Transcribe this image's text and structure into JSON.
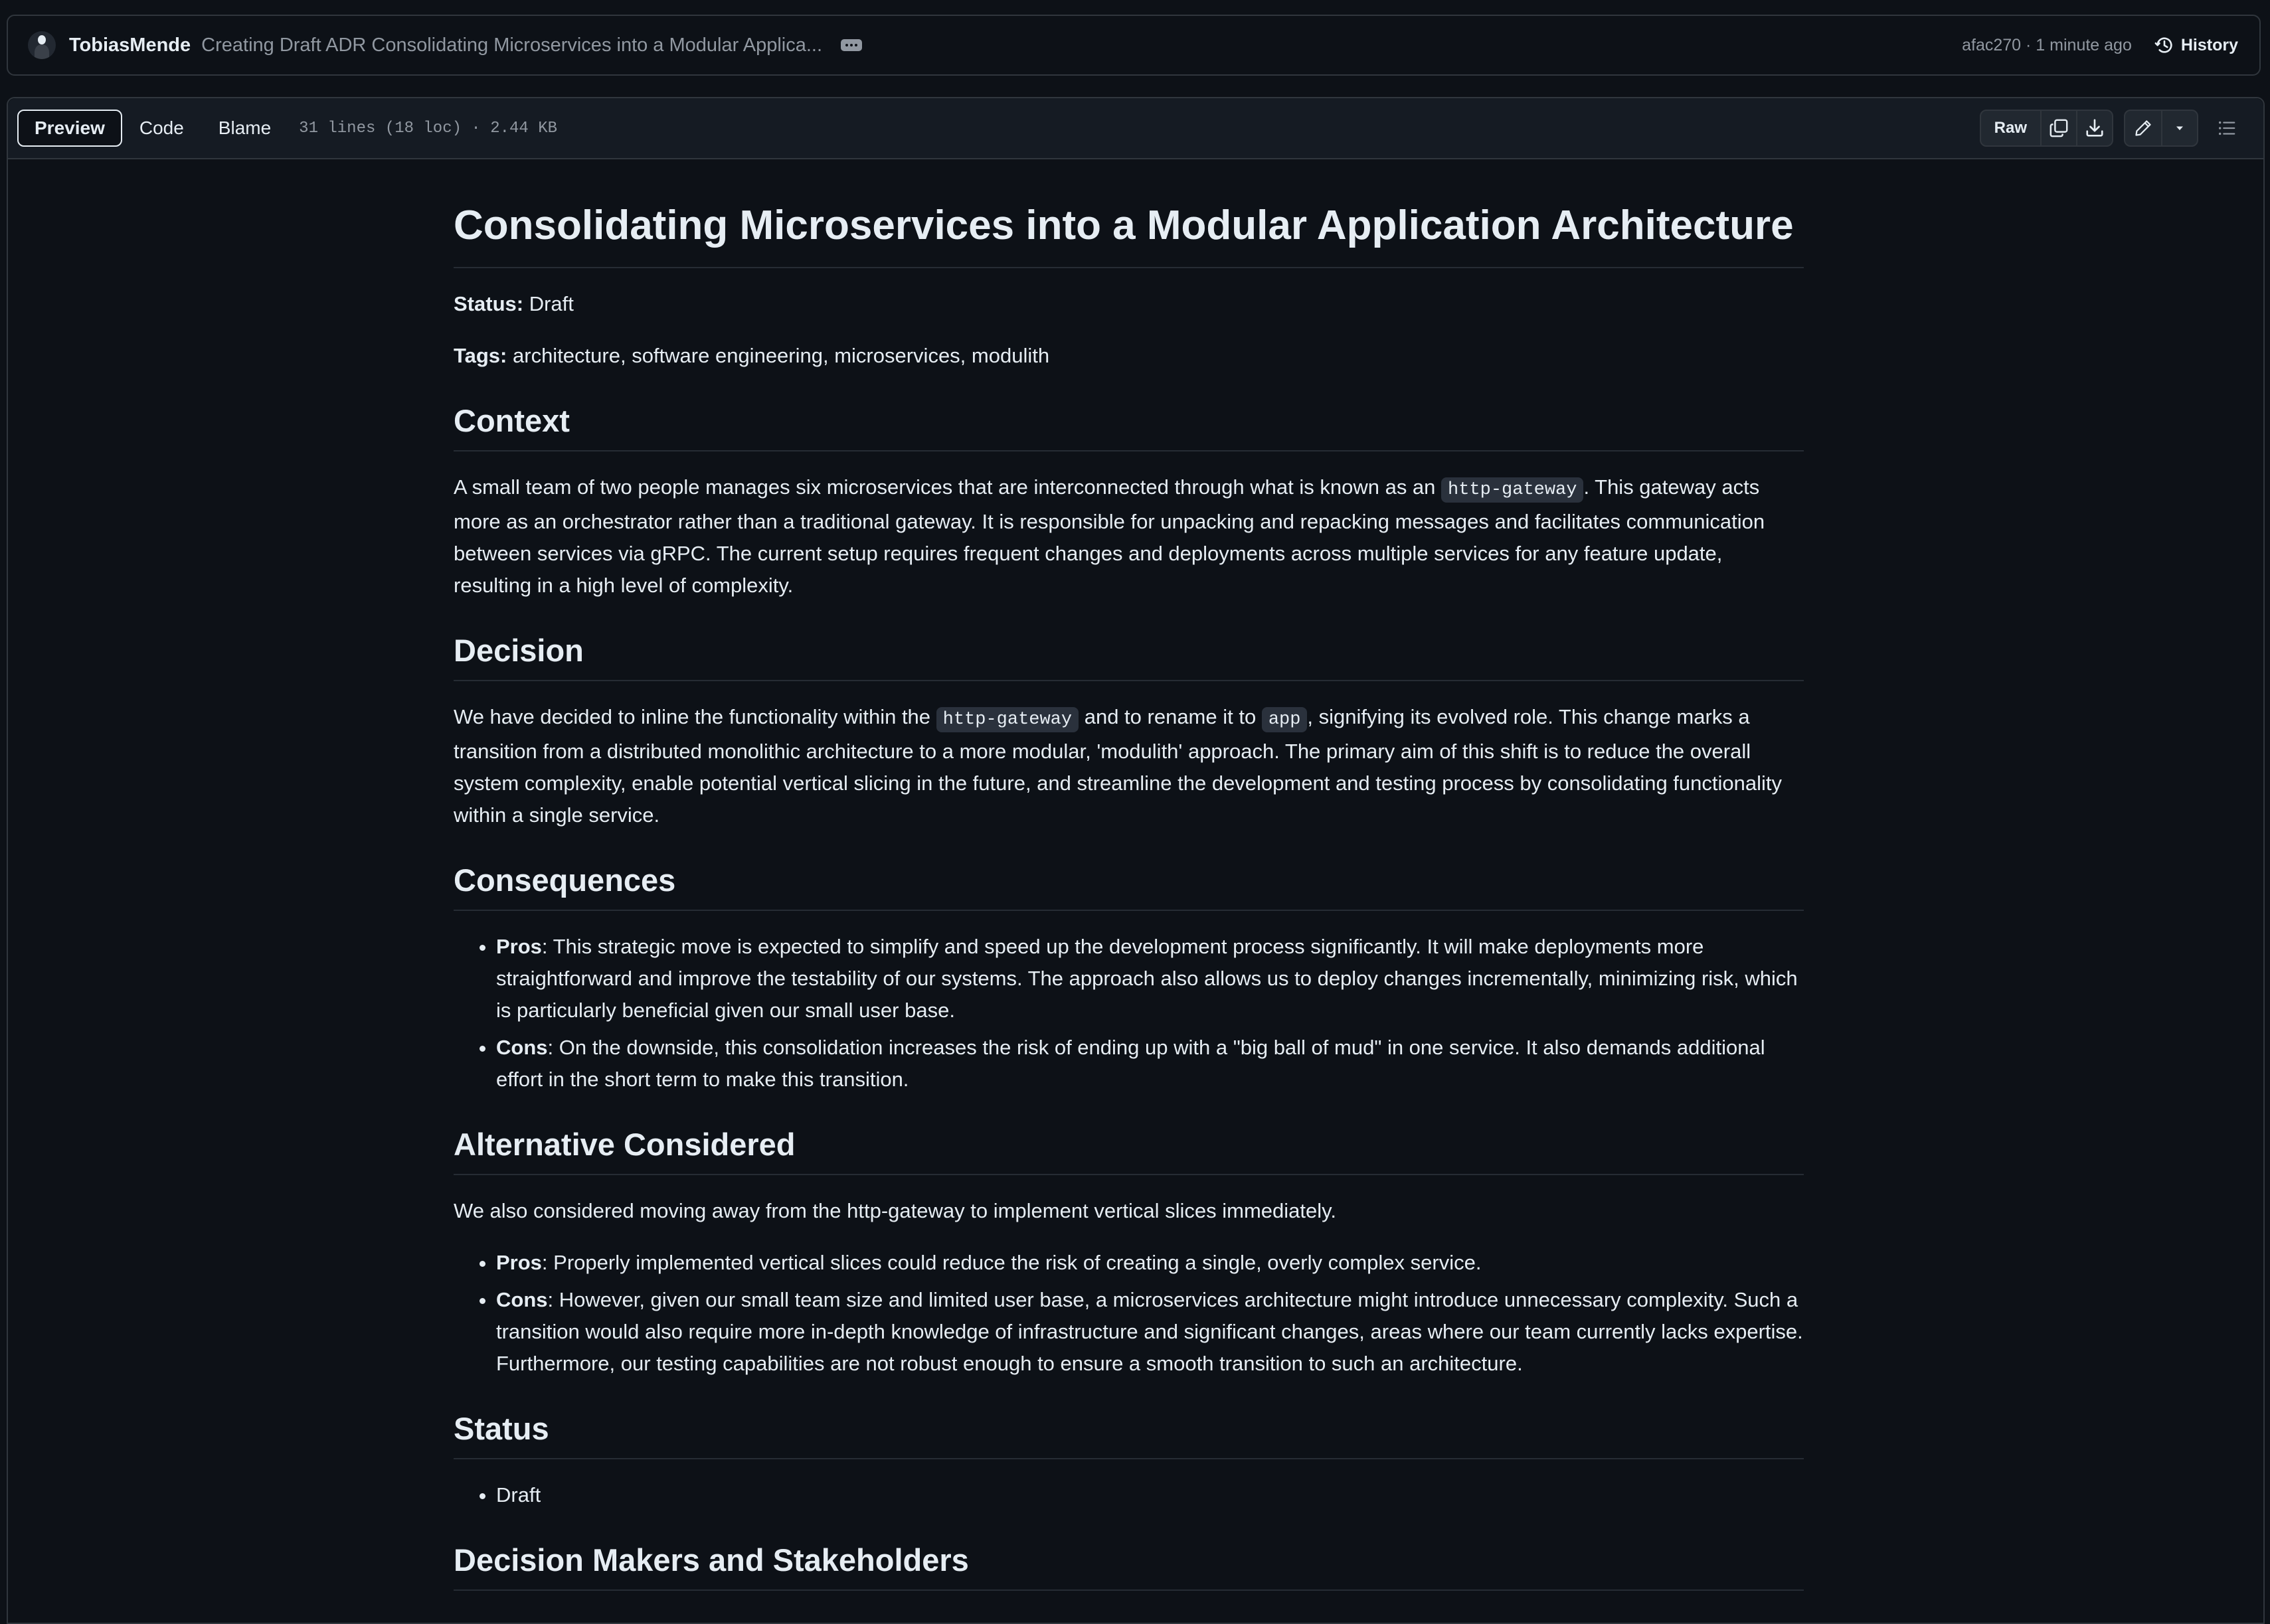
{
  "commit": {
    "author": "TobiasMende",
    "message": "Creating Draft ADR Consolidating Microservices into a Modular Applica...",
    "sha_time": "afac270 · 1 minute ago",
    "history_label": "History"
  },
  "file_header": {
    "tabs": [
      "Preview",
      "Code",
      "Blame"
    ],
    "info": "31 lines (18 loc) · 2.44 KB",
    "raw_label": "Raw"
  },
  "doc": {
    "title": "Consolidating Microservices into a Modular Application Architecture",
    "status_label": "Status:",
    "status_value": " Draft",
    "tags_label": "Tags:",
    "tags_value": " architecture, software engineering, microservices, modulith",
    "context": {
      "heading": "Context",
      "p1_a": "A small team of two people manages six microservices that are interconnected through what is known as an ",
      "p1_code": "http-gateway",
      "p1_b": ". This gateway acts more as an orchestrator rather than a traditional gateway. It is responsible for unpacking and repacking messages and facilitates communication between services via gRPC. The current setup requires frequent changes and deployments across multiple services for any feature update, resulting in a high level of complexity."
    },
    "decision": {
      "heading": "Decision",
      "p_a": "We have decided to inline the functionality within the ",
      "p_code1": "http-gateway",
      "p_b": " and to rename it to ",
      "p_code2": "app",
      "p_c": ", signifying its evolved role. This change marks a transition from a distributed monolithic architecture to a more modular, 'modulith' approach. The primary aim of this shift is to reduce the overall system complexity, enable potential vertical slicing in the future, and streamline the development and testing process by consolidating functionality within a single service."
    },
    "consequences": {
      "heading": "Consequences",
      "items": [
        {
          "label": "Pros",
          "text": ": This strategic move is expected to simplify and speed up the development process significantly. It will make deployments more straightforward and improve the testability of our systems. The approach also allows us to deploy changes incrementally, minimizing risk, which is particularly beneficial given our small user base."
        },
        {
          "label": "Cons",
          "text": ": On the downside, this consolidation increases the risk of ending up with a \"big ball of mud\" in one service. It also demands additional effort in the short term to make this transition."
        }
      ]
    },
    "alternative": {
      "heading": "Alternative Considered",
      "intro": "We also considered moving away from the http-gateway to implement vertical slices immediately.",
      "items": [
        {
          "label": "Pros",
          "text": ": Properly implemented vertical slices could reduce the risk of creating a single, overly complex service."
        },
        {
          "label": "Cons",
          "text": ": However, given our small team size and limited user base, a microservices architecture might introduce unnecessary complexity. Such a transition would also require more in-depth knowledge of infrastructure and significant changes, areas where our team currently lacks expertise. Furthermore, our testing capabilities are not robust enough to ensure a smooth transition to such an architecture."
        }
      ]
    },
    "status_section": {
      "heading": "Status",
      "items": [
        "Draft"
      ]
    },
    "next_heading": "Decision Makers and Stakeholders"
  },
  "colors": {
    "background": "#0d1117",
    "header_bg": "#151b23",
    "border": "#30363d",
    "text": "#e6edf3",
    "muted": "#9198a1",
    "code_bg": "#2a313c"
  },
  "icons": [
    "avatar",
    "ellipsis-icon",
    "history-icon",
    "copy-icon",
    "download-icon",
    "pencil-icon",
    "chevron-down-icon",
    "list-icon"
  ]
}
